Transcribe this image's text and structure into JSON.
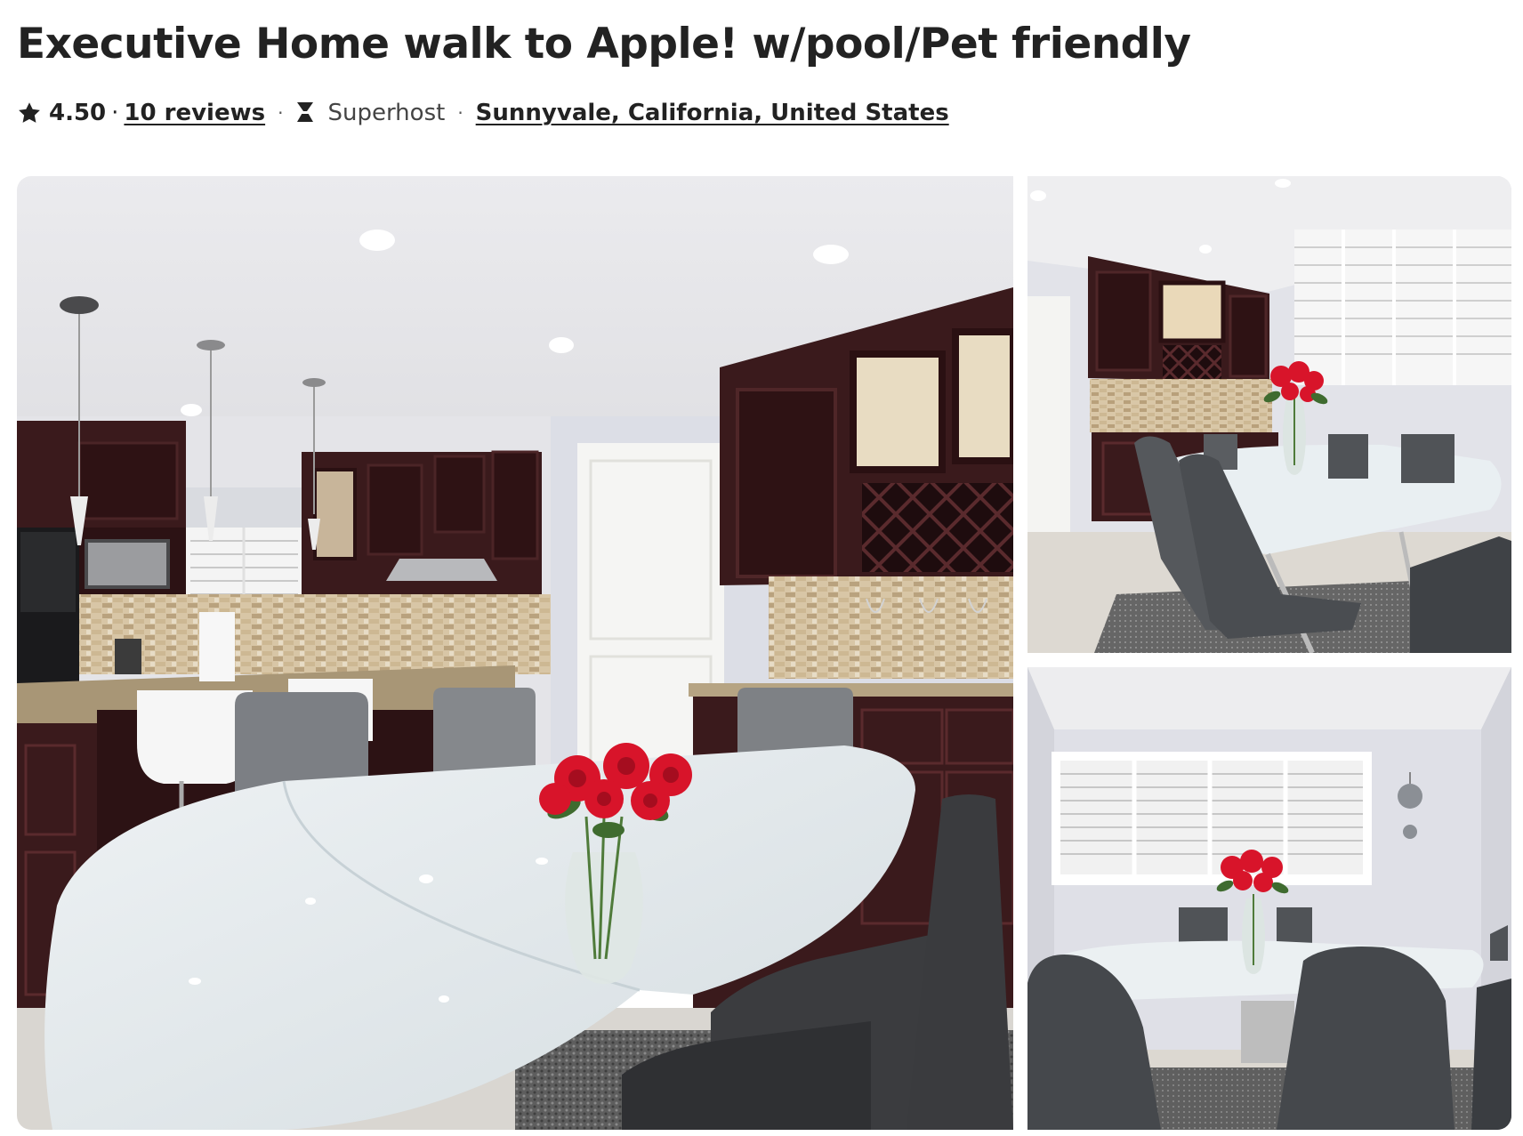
{
  "listing": {
    "title": "Executive Home walk to Apple! w/pool/Pet friendly",
    "rating": "4.50",
    "rating_separator": "·",
    "reviews_label": "10 reviews",
    "meta_separator": "·",
    "superhost_label": "Superhost",
    "location": "Sunnyvale, California, United States"
  },
  "icons": {
    "rating": "star-icon",
    "superhost": "superhost-badge-icon"
  },
  "gallery": {
    "photos": [
      {
        "subject": "kitchen-dining-photo"
      },
      {
        "subject": "dining-area-photo"
      },
      {
        "subject": "dining-room-photo"
      }
    ]
  },
  "colors": {
    "text": "#222222",
    "cabinet": "#3a1a1c",
    "rose": "#d8142a",
    "wall": "#dfe1e8",
    "table": "#e6ecef",
    "chair": "#5a5d61"
  }
}
